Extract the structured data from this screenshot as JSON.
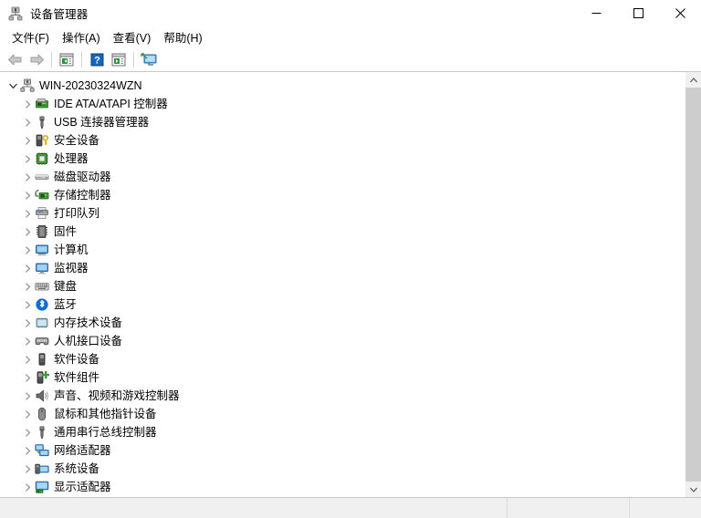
{
  "window": {
    "title": "设备管理器",
    "icon": "device-manager-icon",
    "controls": {
      "minimize": "minimize-button",
      "maximize": "maximize-button",
      "close": "close-button"
    }
  },
  "menubar": {
    "items": [
      {
        "label": "文件(F)",
        "name": "menu-file"
      },
      {
        "label": "操作(A)",
        "name": "menu-action"
      },
      {
        "label": "查看(V)",
        "name": "menu-view"
      },
      {
        "label": "帮助(H)",
        "name": "menu-help"
      }
    ]
  },
  "toolbar": {
    "buttons": [
      {
        "name": "back-button",
        "icon": "back-arrow-icon",
        "enabled": false
      },
      {
        "name": "forward-button",
        "icon": "forward-arrow-icon",
        "enabled": false
      },
      {
        "name": "properties-button",
        "icon": "properties-icon",
        "enabled": true
      },
      {
        "name": "help-button",
        "icon": "help-question-icon",
        "enabled": true
      },
      {
        "name": "show-hidden-button",
        "icon": "list-play-icon",
        "enabled": true
      },
      {
        "name": "scan-hardware-button",
        "icon": "scan-monitor-icon",
        "enabled": true
      }
    ]
  },
  "tree": {
    "root": {
      "label": "WIN-20230324WZN",
      "icon": "computer-network-icon",
      "expanded": true,
      "name": "tree-root-node"
    },
    "items": [
      {
        "label": "IDE ATA/ATAPI 控制器",
        "icon": "ide-controller-icon",
        "name": "tree-item-ide-ata-atapi-controllers"
      },
      {
        "label": "USB 连接器管理器",
        "icon": "usb-connector-icon",
        "name": "tree-item-usb-connector-managers"
      },
      {
        "label": "安全设备",
        "icon": "security-device-icon",
        "name": "tree-item-security-devices"
      },
      {
        "label": "处理器",
        "icon": "processor-chip-icon",
        "name": "tree-item-processors"
      },
      {
        "label": "磁盘驱动器",
        "icon": "disk-drive-icon",
        "name": "tree-item-disk-drives"
      },
      {
        "label": "存储控制器",
        "icon": "storage-controller-icon",
        "name": "tree-item-storage-controllers"
      },
      {
        "label": "打印队列",
        "icon": "print-queue-icon",
        "name": "tree-item-print-queues"
      },
      {
        "label": "固件",
        "icon": "firmware-icon",
        "name": "tree-item-firmware"
      },
      {
        "label": "计算机",
        "icon": "computer-icon",
        "name": "tree-item-computer"
      },
      {
        "label": "监视器",
        "icon": "monitor-icon",
        "name": "tree-item-monitors"
      },
      {
        "label": "键盘",
        "icon": "keyboard-icon",
        "name": "tree-item-keyboards"
      },
      {
        "label": "蓝牙",
        "icon": "bluetooth-icon",
        "name": "tree-item-bluetooth"
      },
      {
        "label": "内存技术设备",
        "icon": "memory-technology-icon",
        "name": "tree-item-memory-technology-devices"
      },
      {
        "label": "人机接口设备",
        "icon": "human-interface-icon",
        "name": "tree-item-human-interface-devices"
      },
      {
        "label": "软件设备",
        "icon": "software-device-icon",
        "name": "tree-item-software-devices"
      },
      {
        "label": "软件组件",
        "icon": "software-component-icon",
        "name": "tree-item-software-components"
      },
      {
        "label": "声音、视频和游戏控制器",
        "icon": "sound-speaker-icon",
        "name": "tree-item-sound-video-game-controllers"
      },
      {
        "label": "鼠标和其他指针设备",
        "icon": "mouse-icon",
        "name": "tree-item-mice-and-pointing-devices"
      },
      {
        "label": "通用串行总线控制器",
        "icon": "usb-controller-icon",
        "name": "tree-item-universal-serial-bus-controllers"
      },
      {
        "label": "网络适配器",
        "icon": "network-adapter-icon",
        "name": "tree-item-network-adapters"
      },
      {
        "label": "系统设备",
        "icon": "system-device-icon",
        "name": "tree-item-system-devices"
      },
      {
        "label": "显示适配器",
        "icon": "display-adapter-icon",
        "name": "tree-item-display-adapters"
      }
    ]
  },
  "scrollbar": {
    "up": "scroll-up-arrow",
    "down": "scroll-down-arrow",
    "thumb": "scroll-thumb"
  },
  "statusbar": {
    "main": "",
    "cell_b": "",
    "cell_c": ""
  },
  "colors": {
    "accent": "#0078d7",
    "titlebar_bg": "#ffffff",
    "toolbar_bg": "#ffffff",
    "tree_bg": "#ffffff",
    "statusbar_bg": "#f0f0f0",
    "scrollbar_thumb": "#cdcdcd",
    "bluetooth_blue": "#0a6ed1",
    "icon_green": "#3f9c35"
  }
}
